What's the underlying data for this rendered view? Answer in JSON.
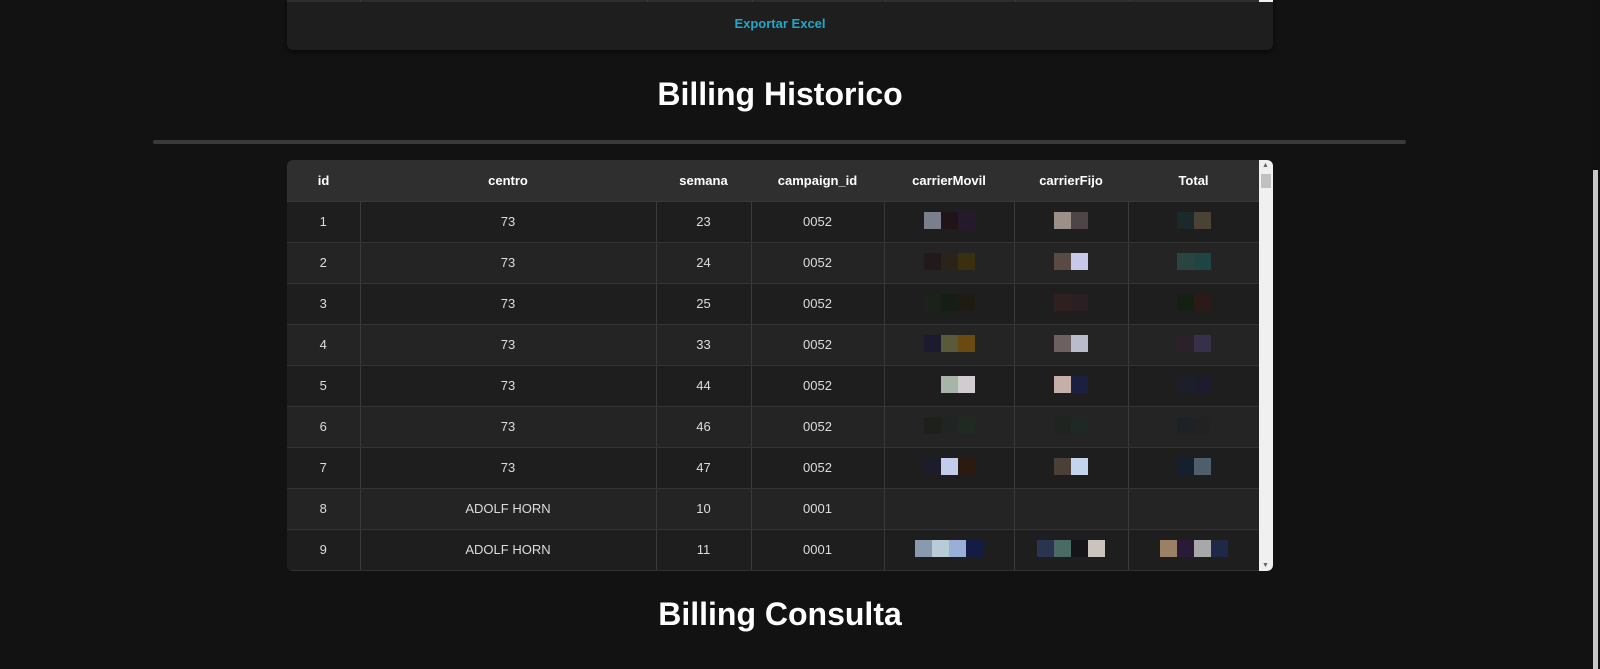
{
  "top_card": {
    "export_label": "Exportar Excel"
  },
  "historico": {
    "title": "Billing Historico",
    "columns": [
      "id",
      "centro",
      "semana",
      "campaign_id",
      "carrierMovil",
      "carrierFijo",
      "Total"
    ],
    "rows": [
      [
        "1",
        "73",
        "23",
        "0052"
      ],
      [
        "2",
        "73",
        "24",
        "0052"
      ],
      [
        "3",
        "73",
        "25",
        "0052"
      ],
      [
        "4",
        "73",
        "33",
        "0052"
      ],
      [
        "5",
        "73",
        "44",
        "0052"
      ],
      [
        "6",
        "73",
        "46",
        "0052"
      ],
      [
        "7",
        "73",
        "47",
        "0052"
      ],
      [
        "8",
        "ADOLF HORN",
        "10",
        "0001"
      ],
      [
        "9",
        "ADOLF HORN",
        "11",
        "0001"
      ]
    ]
  },
  "consulta": {
    "title": "Billing Consulta"
  },
  "colors": {
    "accent": "#1fa8c9",
    "background": "#121212",
    "header": "#2f2f2f"
  }
}
